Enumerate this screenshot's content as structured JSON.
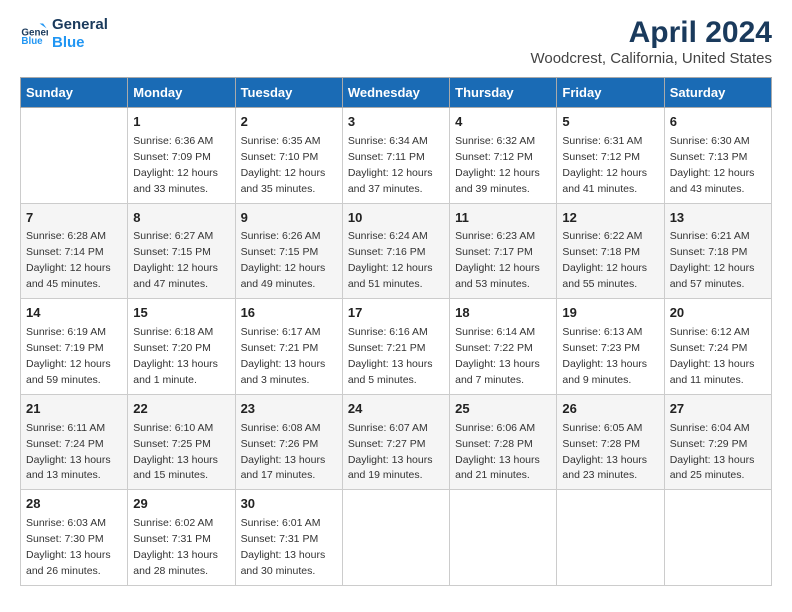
{
  "header": {
    "logo_line1": "General",
    "logo_line2": "Blue",
    "title": "April 2024",
    "subtitle": "Woodcrest, California, United States"
  },
  "days_of_week": [
    "Sunday",
    "Monday",
    "Tuesday",
    "Wednesday",
    "Thursday",
    "Friday",
    "Saturday"
  ],
  "weeks": [
    [
      {
        "day": "",
        "detail": ""
      },
      {
        "day": "1",
        "detail": "Sunrise: 6:36 AM\nSunset: 7:09 PM\nDaylight: 12 hours\nand 33 minutes."
      },
      {
        "day": "2",
        "detail": "Sunrise: 6:35 AM\nSunset: 7:10 PM\nDaylight: 12 hours\nand 35 minutes."
      },
      {
        "day": "3",
        "detail": "Sunrise: 6:34 AM\nSunset: 7:11 PM\nDaylight: 12 hours\nand 37 minutes."
      },
      {
        "day": "4",
        "detail": "Sunrise: 6:32 AM\nSunset: 7:12 PM\nDaylight: 12 hours\nand 39 minutes."
      },
      {
        "day": "5",
        "detail": "Sunrise: 6:31 AM\nSunset: 7:12 PM\nDaylight: 12 hours\nand 41 minutes."
      },
      {
        "day": "6",
        "detail": "Sunrise: 6:30 AM\nSunset: 7:13 PM\nDaylight: 12 hours\nand 43 minutes."
      }
    ],
    [
      {
        "day": "7",
        "detail": "Sunrise: 6:28 AM\nSunset: 7:14 PM\nDaylight: 12 hours\nand 45 minutes."
      },
      {
        "day": "8",
        "detail": "Sunrise: 6:27 AM\nSunset: 7:15 PM\nDaylight: 12 hours\nand 47 minutes."
      },
      {
        "day": "9",
        "detail": "Sunrise: 6:26 AM\nSunset: 7:15 PM\nDaylight: 12 hours\nand 49 minutes."
      },
      {
        "day": "10",
        "detail": "Sunrise: 6:24 AM\nSunset: 7:16 PM\nDaylight: 12 hours\nand 51 minutes."
      },
      {
        "day": "11",
        "detail": "Sunrise: 6:23 AM\nSunset: 7:17 PM\nDaylight: 12 hours\nand 53 minutes."
      },
      {
        "day": "12",
        "detail": "Sunrise: 6:22 AM\nSunset: 7:18 PM\nDaylight: 12 hours\nand 55 minutes."
      },
      {
        "day": "13",
        "detail": "Sunrise: 6:21 AM\nSunset: 7:18 PM\nDaylight: 12 hours\nand 57 minutes."
      }
    ],
    [
      {
        "day": "14",
        "detail": "Sunrise: 6:19 AM\nSunset: 7:19 PM\nDaylight: 12 hours\nand 59 minutes."
      },
      {
        "day": "15",
        "detail": "Sunrise: 6:18 AM\nSunset: 7:20 PM\nDaylight: 13 hours\nand 1 minute."
      },
      {
        "day": "16",
        "detail": "Sunrise: 6:17 AM\nSunset: 7:21 PM\nDaylight: 13 hours\nand 3 minutes."
      },
      {
        "day": "17",
        "detail": "Sunrise: 6:16 AM\nSunset: 7:21 PM\nDaylight: 13 hours\nand 5 minutes."
      },
      {
        "day": "18",
        "detail": "Sunrise: 6:14 AM\nSunset: 7:22 PM\nDaylight: 13 hours\nand 7 minutes."
      },
      {
        "day": "19",
        "detail": "Sunrise: 6:13 AM\nSunset: 7:23 PM\nDaylight: 13 hours\nand 9 minutes."
      },
      {
        "day": "20",
        "detail": "Sunrise: 6:12 AM\nSunset: 7:24 PM\nDaylight: 13 hours\nand 11 minutes."
      }
    ],
    [
      {
        "day": "21",
        "detail": "Sunrise: 6:11 AM\nSunset: 7:24 PM\nDaylight: 13 hours\nand 13 minutes."
      },
      {
        "day": "22",
        "detail": "Sunrise: 6:10 AM\nSunset: 7:25 PM\nDaylight: 13 hours\nand 15 minutes."
      },
      {
        "day": "23",
        "detail": "Sunrise: 6:08 AM\nSunset: 7:26 PM\nDaylight: 13 hours\nand 17 minutes."
      },
      {
        "day": "24",
        "detail": "Sunrise: 6:07 AM\nSunset: 7:27 PM\nDaylight: 13 hours\nand 19 minutes."
      },
      {
        "day": "25",
        "detail": "Sunrise: 6:06 AM\nSunset: 7:28 PM\nDaylight: 13 hours\nand 21 minutes."
      },
      {
        "day": "26",
        "detail": "Sunrise: 6:05 AM\nSunset: 7:28 PM\nDaylight: 13 hours\nand 23 minutes."
      },
      {
        "day": "27",
        "detail": "Sunrise: 6:04 AM\nSunset: 7:29 PM\nDaylight: 13 hours\nand 25 minutes."
      }
    ],
    [
      {
        "day": "28",
        "detail": "Sunrise: 6:03 AM\nSunset: 7:30 PM\nDaylight: 13 hours\nand 26 minutes."
      },
      {
        "day": "29",
        "detail": "Sunrise: 6:02 AM\nSunset: 7:31 PM\nDaylight: 13 hours\nand 28 minutes."
      },
      {
        "day": "30",
        "detail": "Sunrise: 6:01 AM\nSunset: 7:31 PM\nDaylight: 13 hours\nand 30 minutes."
      },
      {
        "day": "",
        "detail": ""
      },
      {
        "day": "",
        "detail": ""
      },
      {
        "day": "",
        "detail": ""
      },
      {
        "day": "",
        "detail": ""
      }
    ]
  ]
}
